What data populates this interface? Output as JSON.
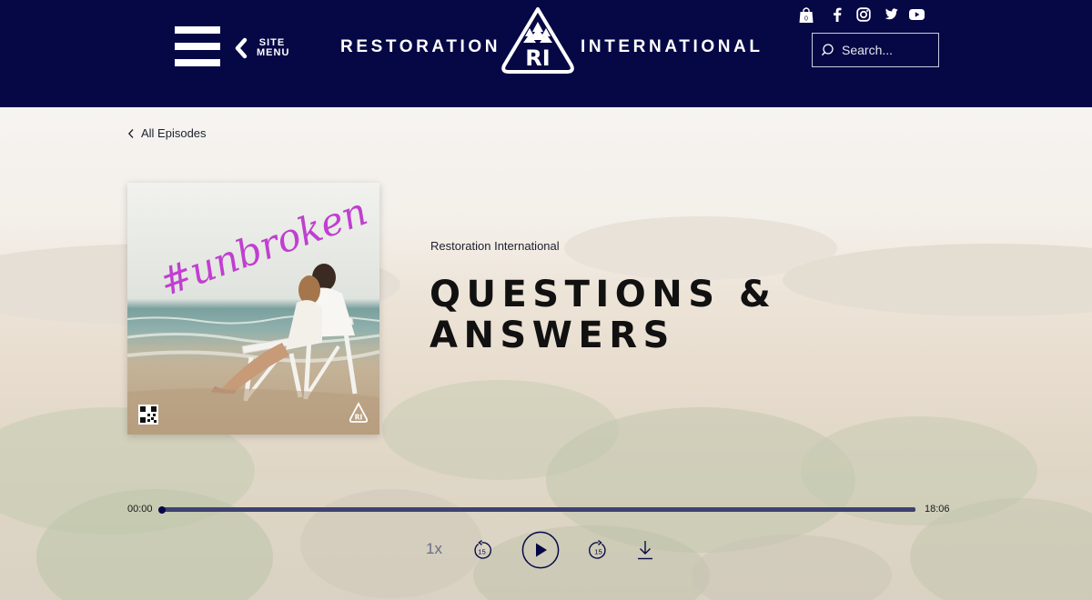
{
  "header": {
    "site_menu_label_1": "SITE",
    "site_menu_label_2": "MENU",
    "brand_left": "RESTORATION",
    "brand_right": "INTERNATIONAL",
    "logo_text": "RI",
    "cart_count": "0",
    "search": {
      "placeholder": "Search..."
    }
  },
  "nav": {
    "back_label": "All Episodes"
  },
  "episode": {
    "show_name": "Restoration International",
    "title_line_1": "QUESTIONS &",
    "title_line_2": "ANSWERS",
    "cover_text": "#unbroken",
    "cover_logo_text": "RI"
  },
  "player": {
    "current_time": "00:00",
    "duration": "18:06",
    "progress_fraction": 0,
    "speed": "1x",
    "skip_back_seconds": "15",
    "skip_forward_seconds": "15"
  },
  "colors": {
    "header_bg": "#060845",
    "accent": "#060845",
    "cover_script": "#c03fd0"
  },
  "icons": [
    "hamburger-icon",
    "chevron-left-icon",
    "cart-icon",
    "facebook-icon",
    "instagram-icon",
    "twitter-icon",
    "youtube-icon",
    "search-icon",
    "rewind-15-icon",
    "play-icon",
    "forward-15-icon",
    "download-icon"
  ]
}
